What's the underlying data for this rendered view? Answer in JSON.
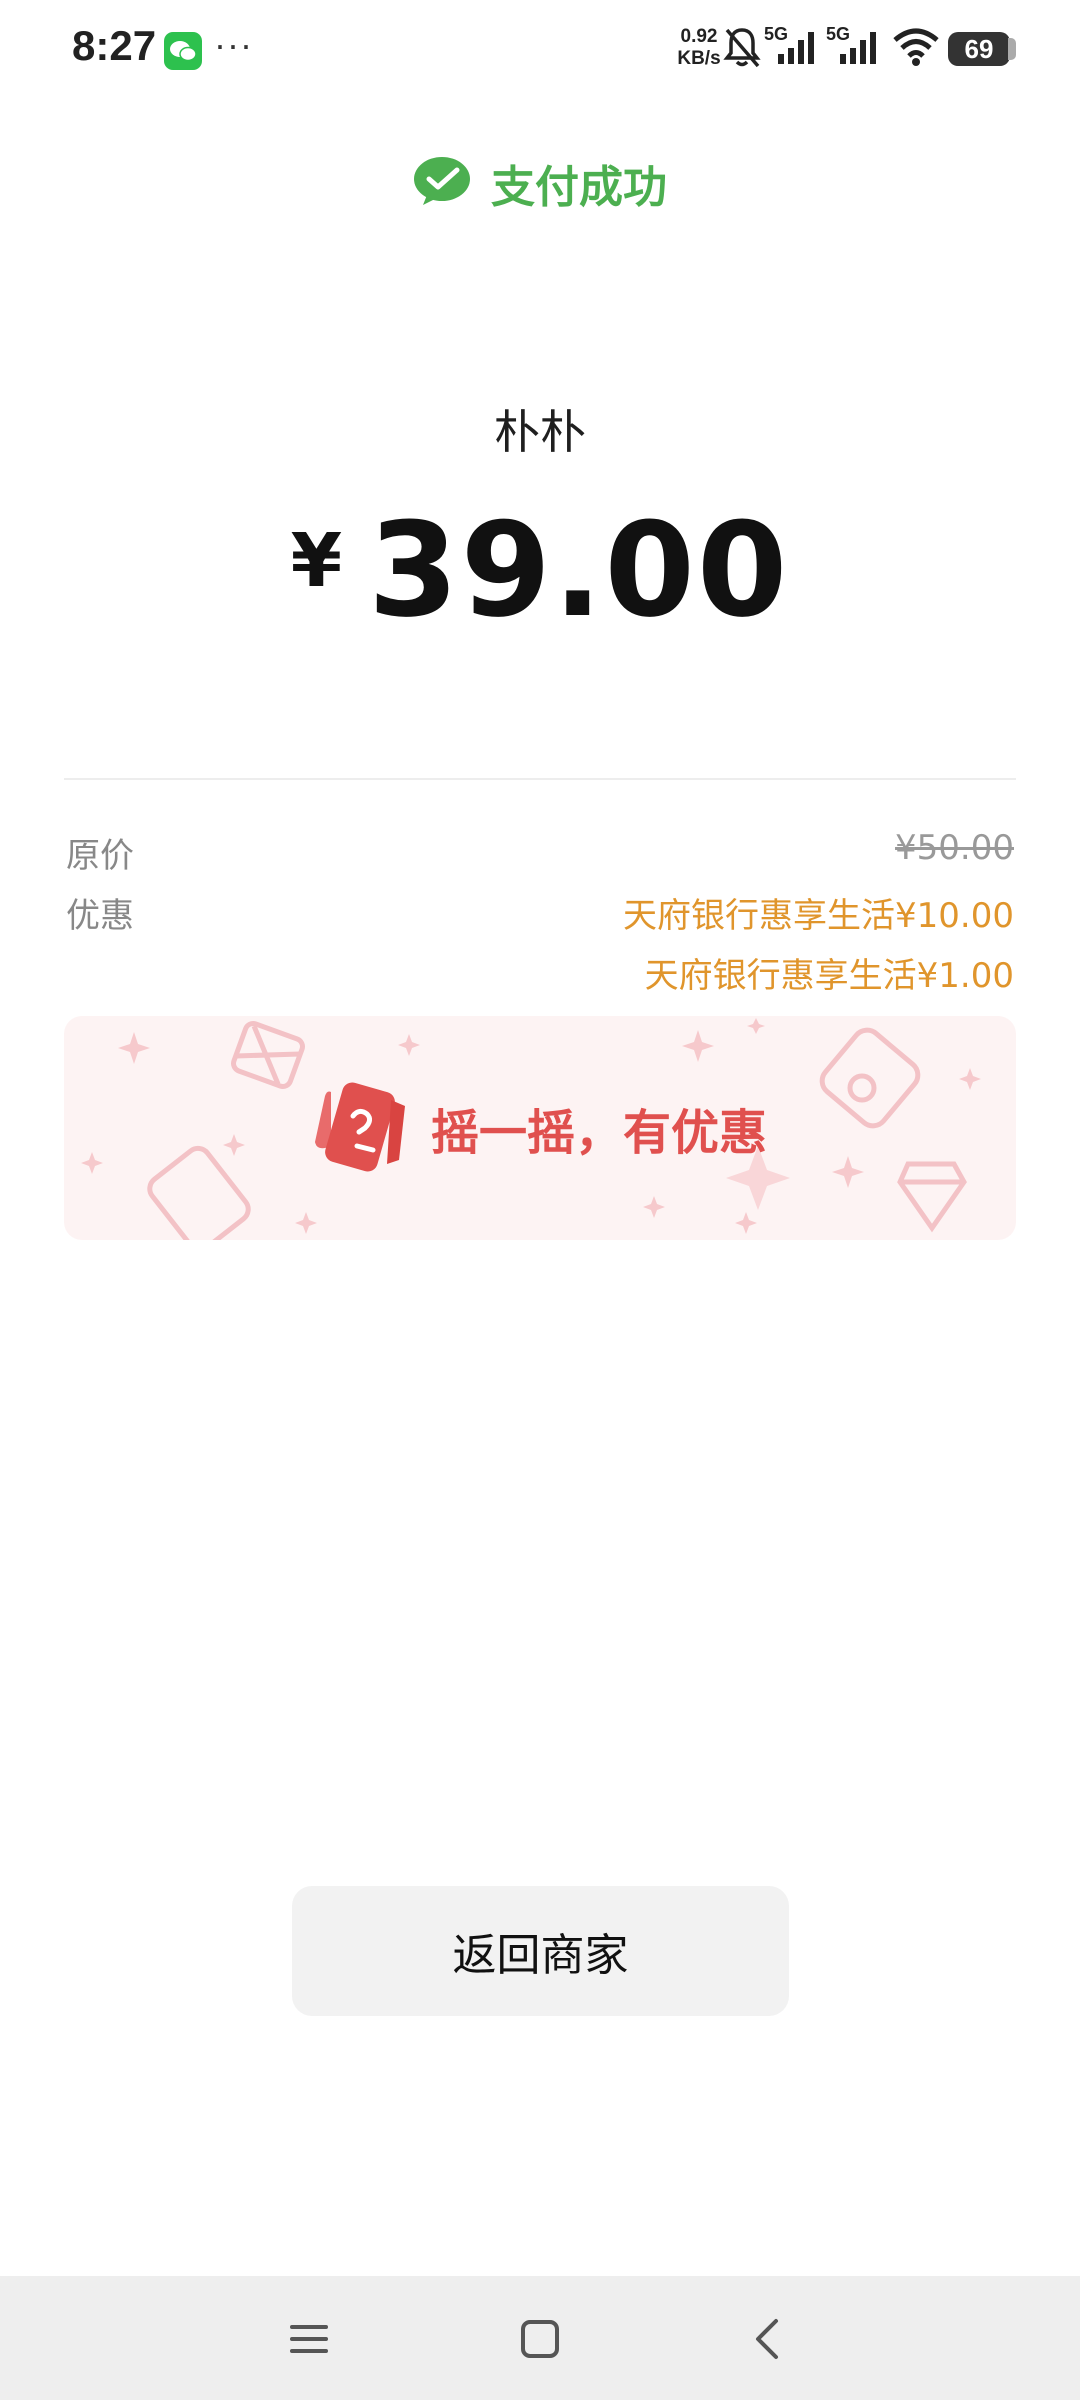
{
  "status_bar": {
    "time": "8:27",
    "more": "···",
    "net_speed_value": "0.92",
    "net_speed_unit": "KB/s",
    "network_1": "5G",
    "network_2": "5G",
    "battery_level": "69",
    "icons": [
      "wechat-icon",
      "bell-muted-icon",
      "signal-icon",
      "signal-icon",
      "wifi-icon",
      "battery-icon"
    ]
  },
  "header": {
    "title": "支付成功",
    "icon": "wechat-pay-check-icon",
    "accent_color": "#4caf50"
  },
  "payment": {
    "merchant": "朴朴",
    "currency_symbol": "¥",
    "amount": "39.00"
  },
  "details": {
    "original_label": "原价",
    "original_value": "¥50.00",
    "discount_label": "优惠",
    "discounts": [
      "天府银行惠享生活¥10.00",
      "天府银行惠享生活¥1.00"
    ],
    "discount_color": "#e0952c"
  },
  "promo": {
    "text": "摇一摇，有优惠",
    "icon": "shake-phone-icon",
    "color": "#e0504e"
  },
  "actions": {
    "back_label": "返回商家"
  },
  "nav": {
    "items": [
      "menu-icon",
      "home-icon",
      "back-icon"
    ]
  }
}
